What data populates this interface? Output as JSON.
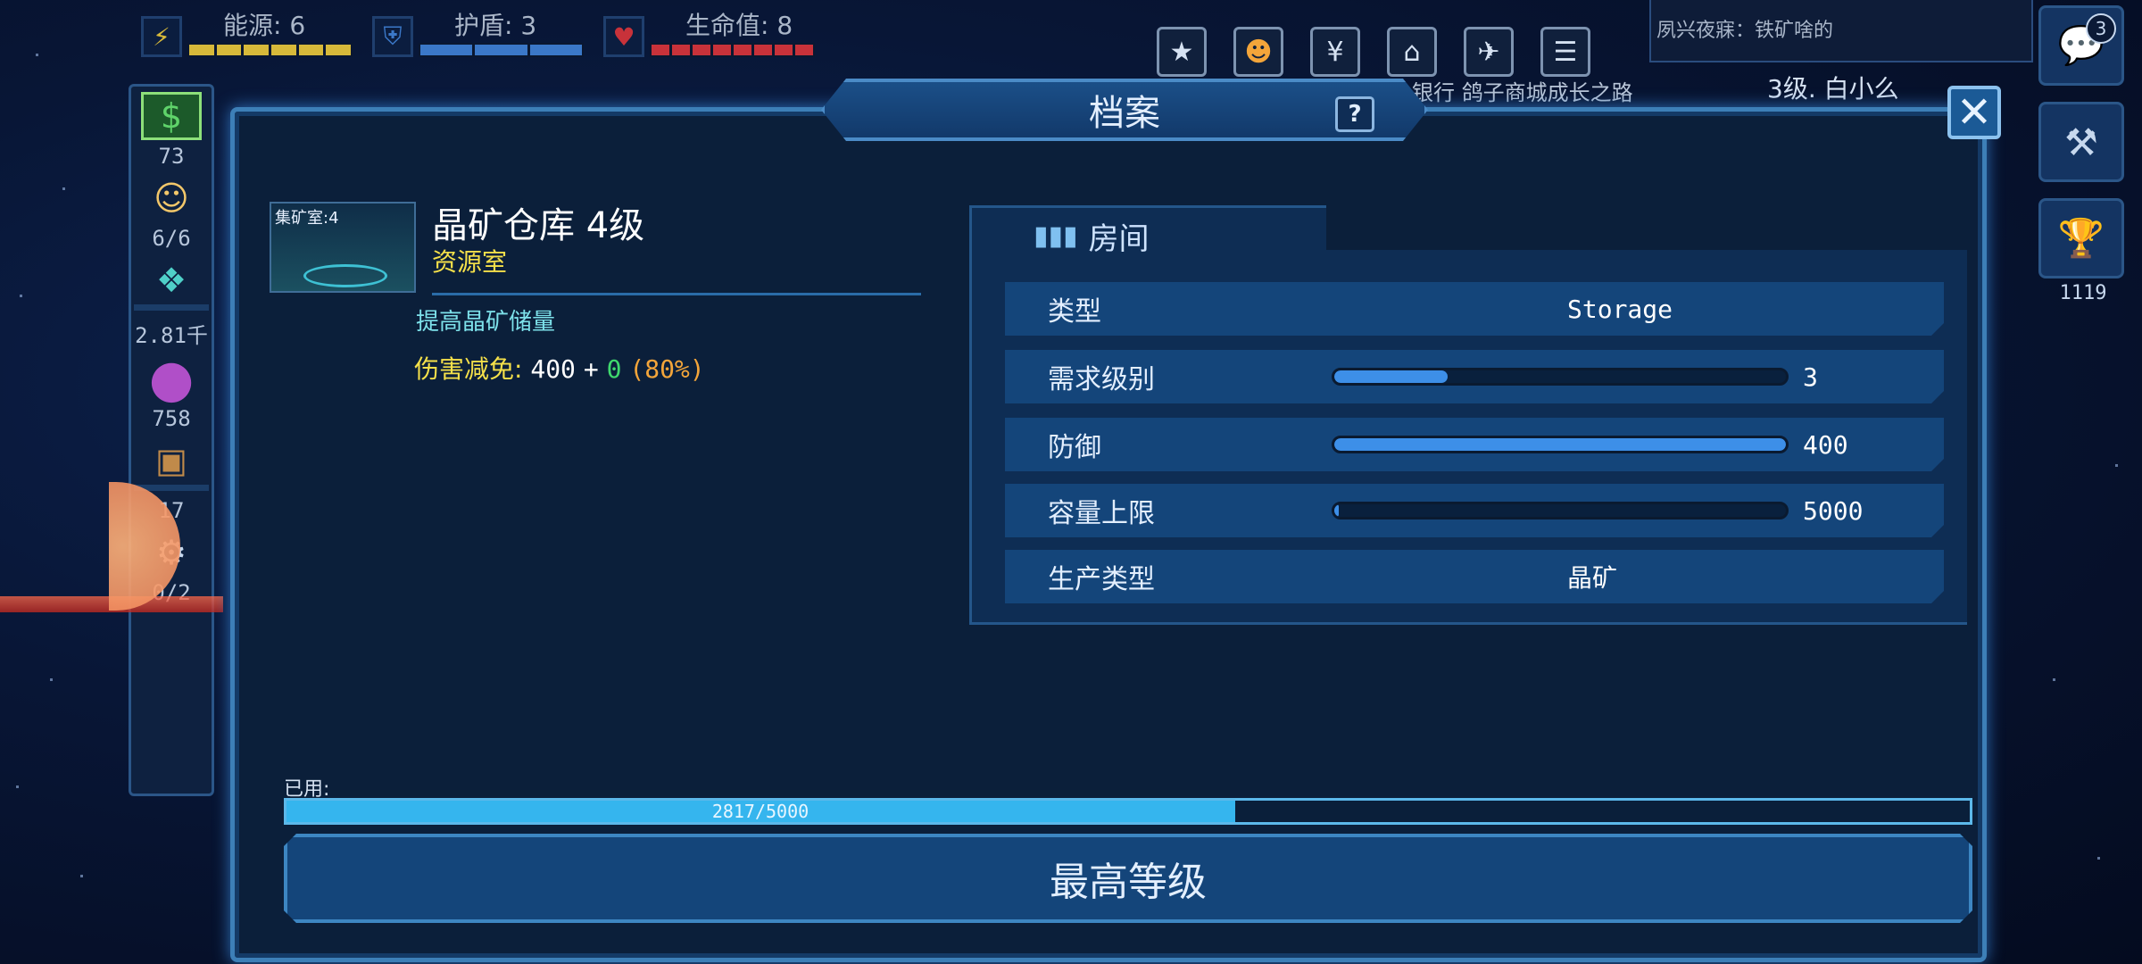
{
  "hud": {
    "energy": {
      "label": "能源: 6",
      "icon": "⚡",
      "color": "#d7b93a",
      "level": 1.0
    },
    "shield": {
      "label": "护盾: 3",
      "icon": "⛨",
      "color": "#3b78c8",
      "level": 1.0
    },
    "health": {
      "label": "生命值: 8",
      "icon": "♥",
      "color": "#c8323a",
      "level": 1.0
    }
  },
  "top_icons": [
    {
      "icon": "star-badge-icon",
      "glyph": "★"
    },
    {
      "icon": "pumpkin-icon",
      "glyph": "☻"
    },
    {
      "icon": "yen-icon",
      "glyph": "¥"
    },
    {
      "icon": "bank-icon",
      "glyph": "⌂"
    },
    {
      "icon": "plane-icon",
      "glyph": "✈"
    },
    {
      "icon": "document-icon",
      "glyph": "☰"
    }
  ],
  "top_labels": "银行  鸽子商城成长之路",
  "notice": "夙兴夜寐：铁矿啥的",
  "player": "3级. 白小么",
  "right_bar": {
    "chat_badge": "3",
    "chat_glyph": "💬",
    "hammer_glyph": "⚒",
    "trophy_glyph": "🏆",
    "trophy_value": "1119"
  },
  "left_bar": [
    {
      "icon": "money-icon",
      "glyph": "$",
      "value": "73"
    },
    {
      "icon": "crew-icon",
      "glyph": "☺",
      "value": "6/6"
    },
    {
      "icon": "crystal-icon",
      "glyph": "❖",
      "value": "2.81千"
    },
    {
      "icon": "planet-icon",
      "glyph": "●",
      "value": "758"
    },
    {
      "icon": "box-icon",
      "glyph": "▣",
      "value": "17"
    },
    {
      "icon": "factory-icon",
      "glyph": "⚙",
      "value": "0/2"
    }
  ],
  "panel": {
    "title": "档案",
    "help": "?",
    "close": "✕"
  },
  "room": {
    "thumb_caption": "集矿室:4",
    "name": "晶矿仓库 4级",
    "type": "资源室",
    "description": "提高晶矿储量",
    "damage_label": "伤害减免:",
    "damage_base": "400",
    "damage_plus": "+",
    "damage_bonus": "0",
    "damage_pct": "(80%)"
  },
  "stats": {
    "header": "房间",
    "rows": [
      {
        "label": "类型",
        "value": "Storage"
      },
      {
        "label": "需求级别",
        "number": "3",
        "level": 0.25
      },
      {
        "label": "防御",
        "number": "400",
        "level": 1.0
      },
      {
        "label": "容量上限",
        "number": "5000",
        "level": 0.0
      },
      {
        "label": "生产类型",
        "value": "晶矿"
      }
    ]
  },
  "used": {
    "label": "已用:",
    "text": "2817/5000",
    "fraction": 0.5634
  },
  "max_button": "最高等级"
}
